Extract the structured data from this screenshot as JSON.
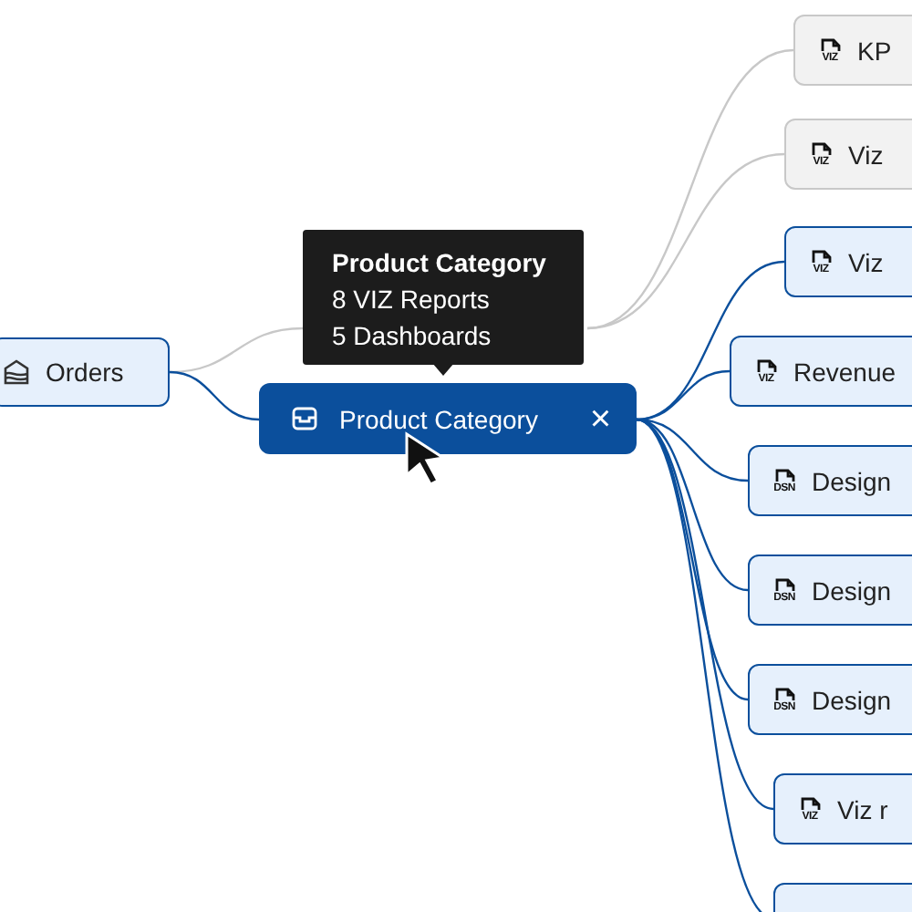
{
  "source_node": {
    "label": "Orders",
    "highlighted": true
  },
  "focus_node": {
    "label": "Product Category",
    "selected": true,
    "close": "×"
  },
  "tooltip": {
    "title": "Product Category",
    "lines": [
      "8 VIZ Reports",
      "5 Dashboards"
    ]
  },
  "targets": [
    {
      "label": "KP",
      "type": "VIZ",
      "highlighted": false
    },
    {
      "label": "Viz",
      "type": "VIZ",
      "highlighted": false
    },
    {
      "label": "Viz",
      "type": "VIZ",
      "highlighted": true
    },
    {
      "label": "Revenue",
      "type": "VIZ",
      "highlighted": true
    },
    {
      "label": "Design",
      "type": "DSN",
      "highlighted": true
    },
    {
      "label": "Design",
      "type": "DSN",
      "highlighted": true
    },
    {
      "label": "Design",
      "type": "DSN",
      "highlighted": true
    },
    {
      "label": "Viz r",
      "type": "VIZ",
      "highlighted": true
    },
    {
      "highlighted": true
    }
  ]
}
